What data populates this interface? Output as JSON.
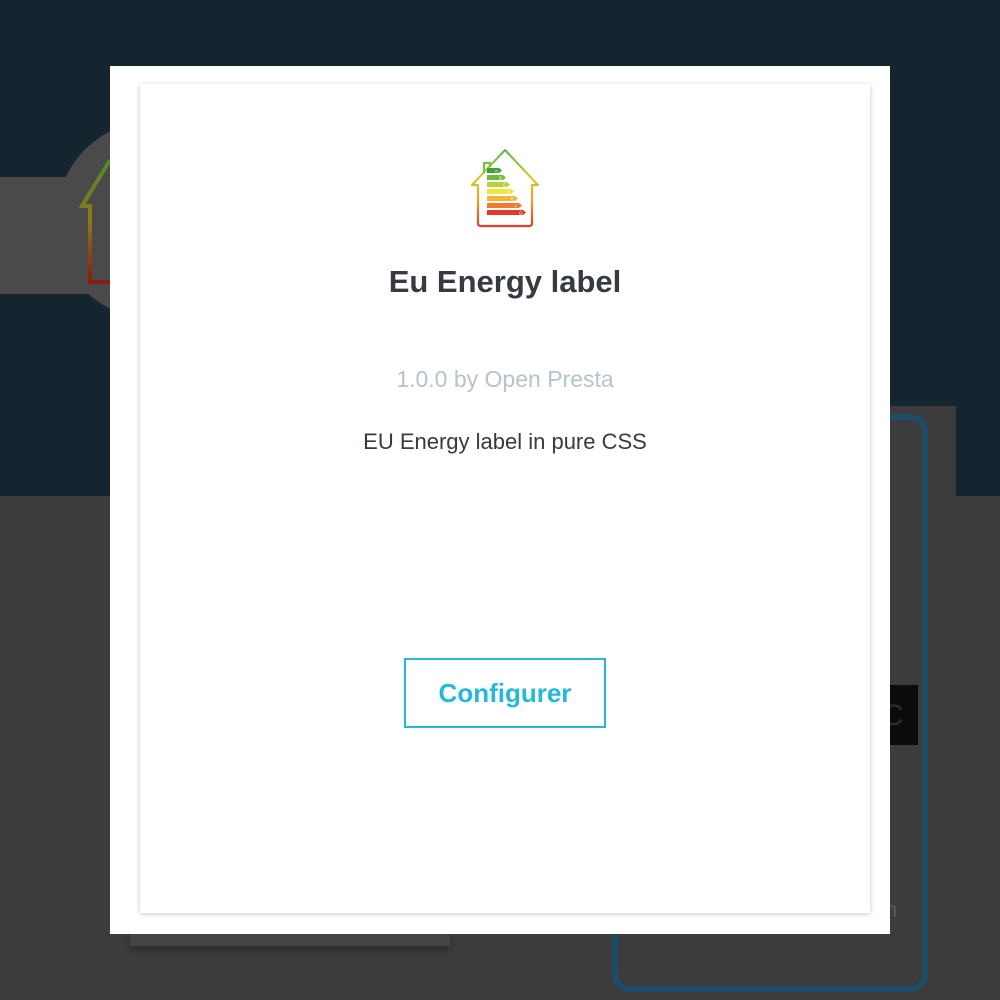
{
  "module": {
    "title": "Eu Energy label",
    "version_author": "1.0.0 by Open Presta",
    "description": "EU Energy label in pure CSS",
    "configure_label": "Configurer",
    "logo_icon": "energy-label-house-icon"
  },
  "background": {
    "button_glyph": "C",
    "trailing_letter": "n"
  },
  "colors": {
    "accent": "#25b9d7",
    "title": "#363a41",
    "muted": "#b5c3cb",
    "overlay_top": "#142530",
    "overlay_bottom": "#3c3c3c"
  }
}
